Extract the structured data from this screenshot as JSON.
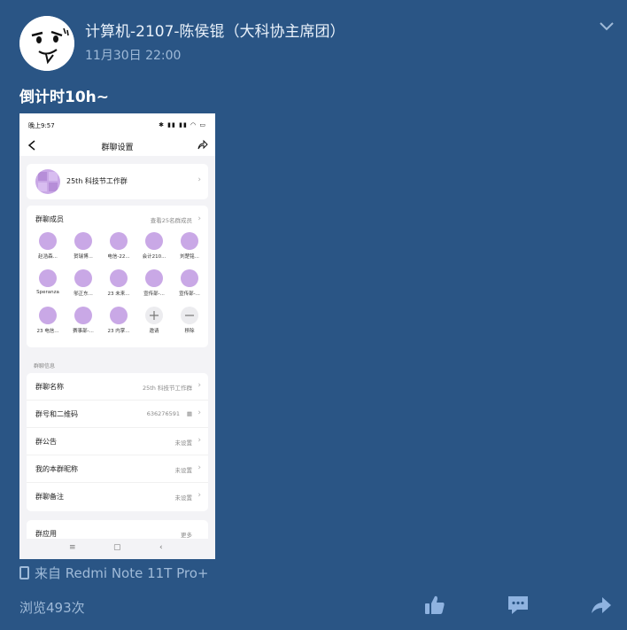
{
  "author": {
    "name": "计算机-2107-陈侯锟（大科协主席团）",
    "time": "11月30日 22:00"
  },
  "post": {
    "text": "倒计时10h~"
  },
  "screenshot": {
    "status_time": "晚上9:57",
    "status_icons": "✱ ▮▮ ▮▮ ◠ ▭",
    "nav_title": "群聊设置",
    "group_name": "25th 科技节工作群",
    "members_title": "群聊成员",
    "members_link": "查看25名群成员",
    "members": [
      "赵浩森...",
      "贺瑞博...",
      "电信-22...",
      "会计210...",
      "刘楚铭...",
      "Speranza",
      "邬正东...",
      "23 未来...",
      "宣传部-...",
      "宣传部-...",
      "23 电信...",
      "赛事部-...",
      "23 内掌...",
      "邀请",
      "移除"
    ],
    "section_label": "群聊信息",
    "info_rows": [
      {
        "key": "群聊名称",
        "value": "25th 科技节工作群"
      },
      {
        "key": "群号和二维码",
        "value": "636276591"
      },
      {
        "key": "群公告",
        "value": "未设置"
      },
      {
        "key": "我的本群昵称",
        "value": "未设置"
      },
      {
        "key": "群聊备注",
        "value": "未设置"
      }
    ],
    "apps_label": "群应用",
    "apps_more": "更多",
    "bottom_nav": [
      "≡",
      "▢",
      "‹"
    ]
  },
  "footer": {
    "source": "来自 Redmi Note 11T Pro+",
    "views": "浏览493次"
  },
  "colors": {
    "background": "#2a5585",
    "muted_text": "#9fbad8",
    "accent_purple": "#c9a8e6"
  }
}
